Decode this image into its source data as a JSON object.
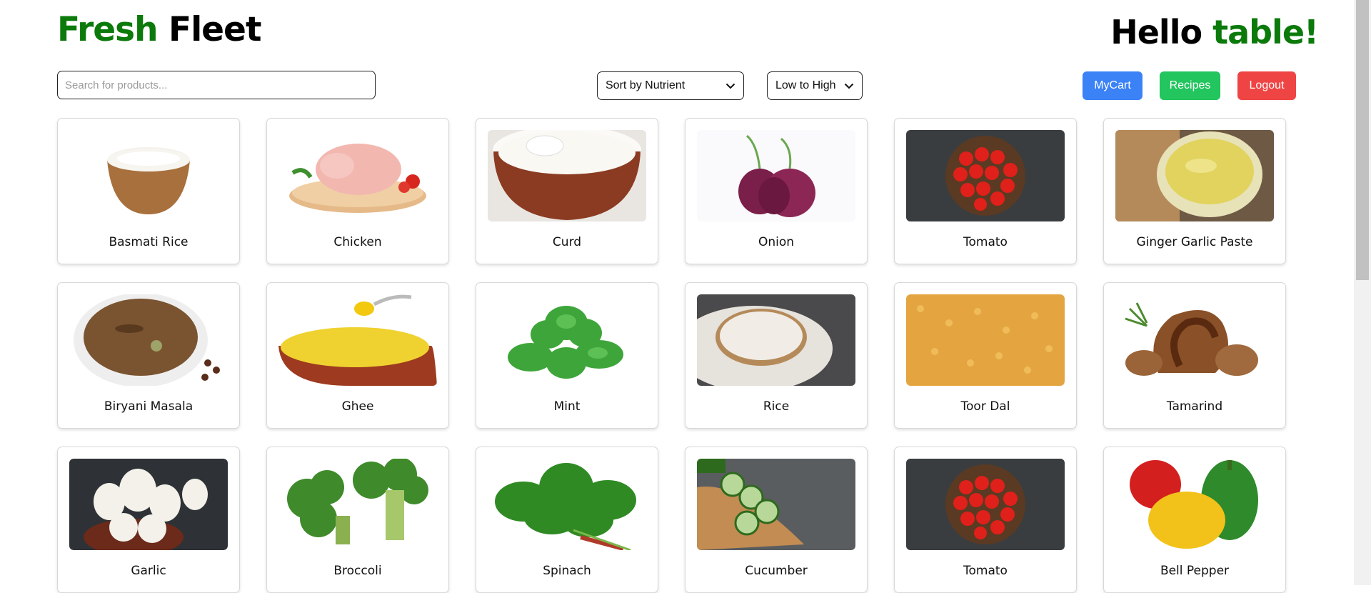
{
  "header": {
    "brand_part1": "Fresh",
    "brand_part2": "Fleet",
    "greeting_part1": "Hello",
    "greeting_part2": "table!"
  },
  "toolbar": {
    "search_placeholder": "Search for products...",
    "sort_selected": "Sort by Nutrient",
    "order_selected": "Low to High",
    "cart_label": "MyCart",
    "recipes_label": "Recipes",
    "logout_label": "Logout"
  },
  "colors": {
    "brand_green": "#0b7a0b",
    "cart_blue": "#3b82f6",
    "recipes_green": "#22c55e",
    "logout_red": "#ef4444"
  },
  "products": [
    {
      "name": "Basmati Rice",
      "icon": "basmati-rice-image"
    },
    {
      "name": "Chicken",
      "icon": "chicken-image"
    },
    {
      "name": "Curd",
      "icon": "curd-image"
    },
    {
      "name": "Onion",
      "icon": "onion-image"
    },
    {
      "name": "Tomato",
      "icon": "tomato-image"
    },
    {
      "name": "Ginger Garlic Paste",
      "icon": "ginger-garlic-paste-image"
    },
    {
      "name": "Biryani Masala",
      "icon": "biryani-masala-image"
    },
    {
      "name": "Ghee",
      "icon": "ghee-image"
    },
    {
      "name": "Mint",
      "icon": "mint-image"
    },
    {
      "name": "Rice",
      "icon": "rice-image"
    },
    {
      "name": "Toor Dal",
      "icon": "toor-dal-image"
    },
    {
      "name": "Tamarind",
      "icon": "tamarind-image"
    },
    {
      "name": "Garlic",
      "icon": "garlic-image"
    },
    {
      "name": "Broccoli",
      "icon": "broccoli-image"
    },
    {
      "name": "Spinach",
      "icon": "spinach-image"
    },
    {
      "name": "Cucumber",
      "icon": "cucumber-image"
    },
    {
      "name": "Tomato",
      "icon": "tomato-image"
    },
    {
      "name": "Bell Pepper",
      "icon": "bell-pepper-image"
    }
  ]
}
